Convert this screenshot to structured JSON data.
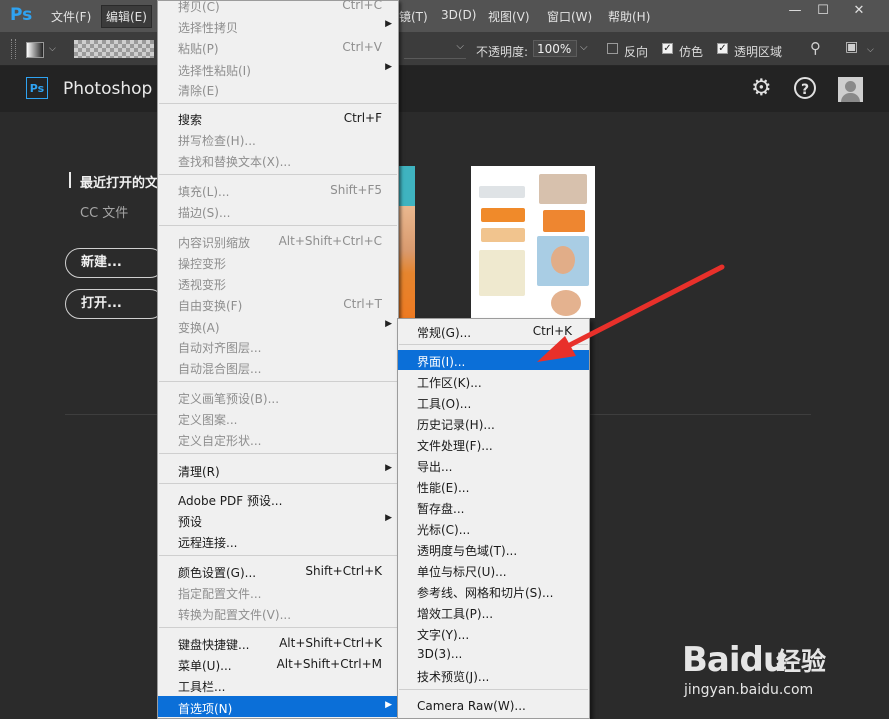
{
  "menubar": {
    "items": [
      {
        "label": "文件(F)"
      },
      {
        "label": "编辑(E)"
      },
      {
        "label": "镜(T)"
      },
      {
        "label": "3D(D)"
      },
      {
        "label": "视图(V)"
      },
      {
        "label": "窗口(W)"
      },
      {
        "label": "帮助(H)"
      }
    ],
    "window": {
      "minimize": "—",
      "maximize": "☐",
      "close": "✕"
    }
  },
  "options": {
    "opacity_label": "不透明度:",
    "opacity_value": "100%",
    "reverse_label": "反向",
    "reverse_checked": false,
    "dither_label": "仿色",
    "dither_checked": true,
    "transparency_label": "透明区域",
    "transparency_checked": true
  },
  "workspace": {
    "app_title": "Photoshop",
    "logo_text": "Ps",
    "recent_title": "最近打开的文",
    "cc_files": "CC 文件",
    "new_button": "新建...",
    "open_button": "打开..."
  },
  "edit_menu": {
    "items": [
      {
        "label": "拷贝(C)",
        "shortcut": "Ctrl+C",
        "disabled": true
      },
      {
        "label": "选择性拷贝",
        "submenu": true,
        "disabled": true
      },
      {
        "label": "粘贴(P)",
        "shortcut": "Ctrl+V",
        "disabled": true
      },
      {
        "label": "选择性粘贴(I)",
        "submenu": true,
        "disabled": true
      },
      {
        "label": "清除(E)",
        "disabled": true
      },
      {
        "label": "搜索",
        "shortcut": "Ctrl+F"
      },
      {
        "label": "拼写检查(H)...",
        "disabled": true
      },
      {
        "label": "查找和替换文本(X)...",
        "disabled": true
      },
      {
        "label": "填充(L)...",
        "shortcut": "Shift+F5",
        "disabled": true
      },
      {
        "label": "描边(S)...",
        "disabled": true
      },
      {
        "label": "内容识别缩放",
        "shortcut": "Alt+Shift+Ctrl+C",
        "disabled": true
      },
      {
        "label": "操控变形",
        "disabled": true
      },
      {
        "label": "透视变形",
        "disabled": true
      },
      {
        "label": "自由变换(F)",
        "shortcut": "Ctrl+T",
        "disabled": true
      },
      {
        "label": "变换(A)",
        "submenu": true,
        "disabled": true
      },
      {
        "label": "自动对齐图层...",
        "disabled": true
      },
      {
        "label": "自动混合图层...",
        "disabled": true
      },
      {
        "label": "定义画笔预设(B)...",
        "disabled": true
      },
      {
        "label": "定义图案...",
        "disabled": true
      },
      {
        "label": "定义自定形状...",
        "disabled": true
      },
      {
        "label": "清理(R)",
        "submenu": true
      },
      {
        "label": "Adobe PDF 预设..."
      },
      {
        "label": "预设",
        "submenu": true
      },
      {
        "label": "远程连接..."
      },
      {
        "label": "颜色设置(G)...",
        "shortcut": "Shift+Ctrl+K"
      },
      {
        "label": "指定配置文件...",
        "disabled": true
      },
      {
        "label": "转换为配置文件(V)...",
        "disabled": true
      },
      {
        "label": "键盘快捷键...",
        "shortcut": "Alt+Shift+Ctrl+K"
      },
      {
        "label": "菜单(U)...",
        "shortcut": "Alt+Shift+Ctrl+M"
      },
      {
        "label": "工具栏..."
      },
      {
        "label": "首选项(N)",
        "submenu": true,
        "highlighted": true
      }
    ]
  },
  "preferences_submenu": {
    "items": [
      {
        "label": "常规(G)...",
        "shortcut": "Ctrl+K"
      },
      {
        "label": "界面(I)...",
        "highlighted": true
      },
      {
        "label": "工作区(K)..."
      },
      {
        "label": "工具(O)..."
      },
      {
        "label": "历史记录(H)..."
      },
      {
        "label": "文件处理(F)..."
      },
      {
        "label": "导出..."
      },
      {
        "label": "性能(E)..."
      },
      {
        "label": "暂存盘..."
      },
      {
        "label": "光标(C)..."
      },
      {
        "label": "透明度与色域(T)..."
      },
      {
        "label": "单位与标尺(U)..."
      },
      {
        "label": "参考线、网格和切片(S)..."
      },
      {
        "label": "增效工具(P)..."
      },
      {
        "label": "文字(Y)..."
      },
      {
        "label": "3D(3)..."
      },
      {
        "label": "技术预览(J)..."
      },
      {
        "label": "Camera Raw(W)..."
      }
    ]
  },
  "watermark": {
    "brand": "Baidu",
    "cn": "经验",
    "url": "jingyan.baidu.com"
  },
  "colors": {
    "highlight": "#0b6fd8",
    "annotation_arrow": "#e8302a",
    "ps_blue": "#2fa3f2"
  }
}
